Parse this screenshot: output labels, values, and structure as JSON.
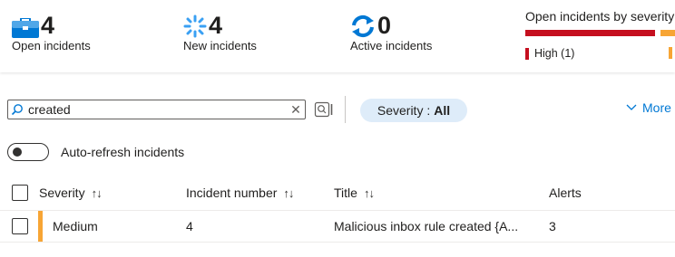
{
  "summary": {
    "open": {
      "value": "4",
      "label": "Open incidents",
      "icon": "briefcase-icon"
    },
    "new": {
      "value": "4",
      "label": "New incidents",
      "icon": "loading-spinner-icon"
    },
    "active": {
      "value": "0",
      "label": "Active incidents",
      "icon": "refresh-icon"
    }
  },
  "severity_panel": {
    "title": "Open incidents by severity",
    "high_label": "High (1)",
    "colors": {
      "high": "#c50f1f",
      "medium": "#f7a535"
    }
  },
  "toolbar": {
    "search_value": "created",
    "severity_filter_label": "Severity : ",
    "severity_filter_value": "All",
    "more_label": "More"
  },
  "auto_refresh_label": "Auto-refresh incidents",
  "table": {
    "columns": [
      "Severity",
      "Incident number",
      "Title",
      "Alerts"
    ],
    "rows": [
      {
        "severity": "Medium",
        "incident_number": "4",
        "title": "Malicious inbox rule created {A...",
        "alerts": "3"
      }
    ]
  },
  "accent_color": "#0078d4"
}
